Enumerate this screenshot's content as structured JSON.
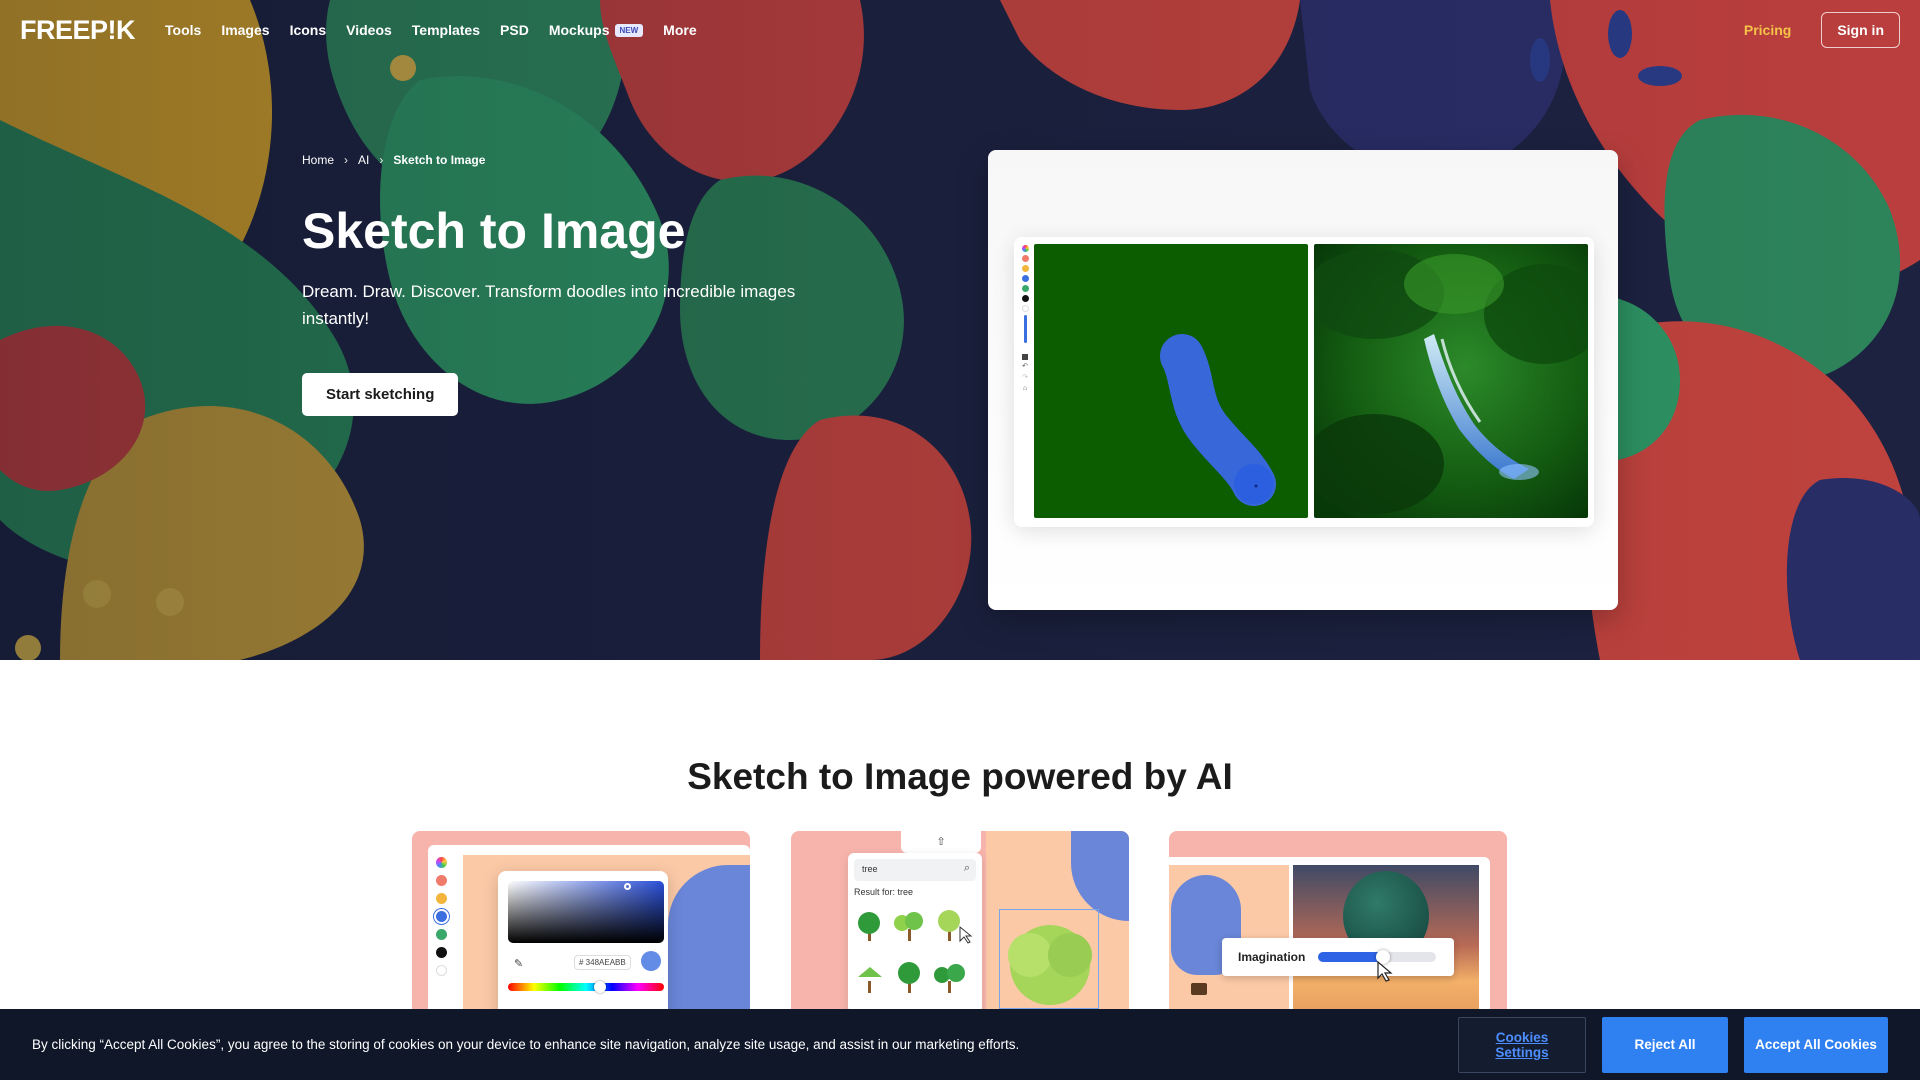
{
  "nav": {
    "logo": "FREEP!K",
    "links": [
      {
        "label": "Tools"
      },
      {
        "label": "Images"
      },
      {
        "label": "Icons"
      },
      {
        "label": "Videos"
      },
      {
        "label": "Templates"
      },
      {
        "label": "PSD"
      },
      {
        "label": "Mockups",
        "badge": "NEW"
      },
      {
        "label": "More"
      }
    ],
    "pricing": "Pricing",
    "signin": "Sign in"
  },
  "breadcrumb": {
    "items": [
      "Home",
      "AI",
      "Sketch to Image"
    ]
  },
  "hero": {
    "title": "Sketch to Image",
    "subtitle": "Dream. Draw. Discover. Transform doodles into incredible images instantly!",
    "cta": "Start sketching"
  },
  "section": {
    "title": "Sketch to Image powered by AI"
  },
  "cards": {
    "color_picker_hex": "# 348AEABB",
    "search_value": "tree",
    "result_label": "Result for: tree",
    "imagination_label": "Imagination",
    "imagination_level": 0.55
  },
  "cookie": {
    "text": "By clicking “Accept All Cookies”, you agree to the storing of cookies on your device to enhance site navigation, analyze site usage, and assist in our marketing efforts.",
    "settings": "Cookies Settings",
    "reject": "Reject All",
    "accept": "Accept All Cookies"
  },
  "colors": {
    "accent_yellow": "#f5c24a",
    "cookie_bg": "#0f1729",
    "cookie_button": "#2f80f1",
    "card_pink": "#f7b4ad",
    "sketch_green": "#0c5c00"
  }
}
